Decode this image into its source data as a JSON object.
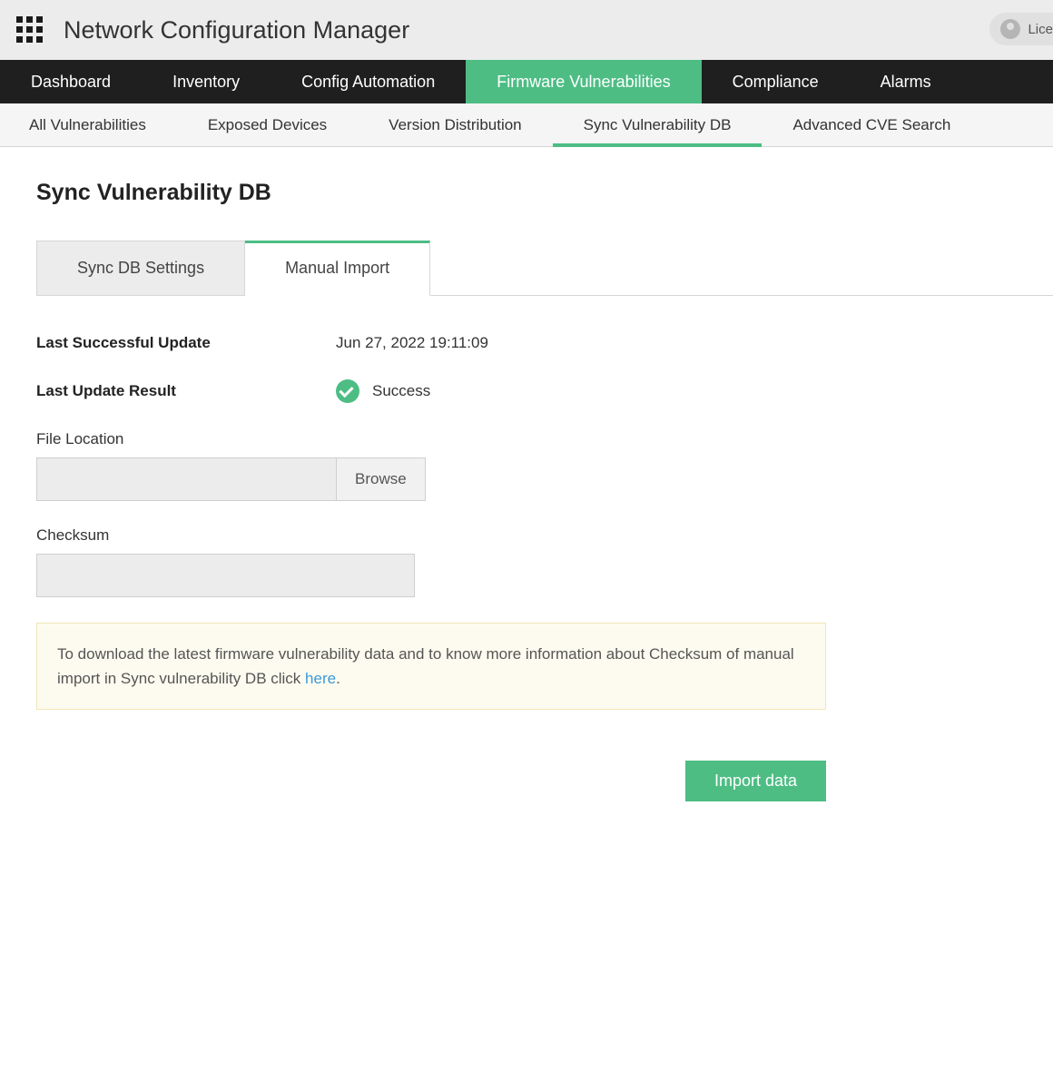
{
  "header": {
    "app_title": "Network Configuration Manager",
    "license_label": "Lice"
  },
  "main_nav": {
    "items": [
      {
        "label": "Dashboard",
        "active": false
      },
      {
        "label": "Inventory",
        "active": false
      },
      {
        "label": "Config Automation",
        "active": false
      },
      {
        "label": "Firmware Vulnerabilities",
        "active": true
      },
      {
        "label": "Compliance",
        "active": false
      },
      {
        "label": "Alarms",
        "active": false
      }
    ]
  },
  "sub_nav": {
    "items": [
      {
        "label": "All Vulnerabilities",
        "active": false
      },
      {
        "label": "Exposed Devices",
        "active": false
      },
      {
        "label": "Version Distribution",
        "active": false
      },
      {
        "label": "Sync Vulnerability DB",
        "active": true
      },
      {
        "label": "Advanced CVE Search",
        "active": false
      }
    ]
  },
  "page": {
    "title": "Sync Vulnerability DB",
    "tabs": [
      {
        "label": "Sync DB Settings",
        "active": false
      },
      {
        "label": "Manual Import",
        "active": true
      }
    ],
    "last_update_label": "Last Successful Update",
    "last_update_value": "Jun 27, 2022 19:11:09",
    "last_result_label": "Last Update Result",
    "last_result_value": "Success",
    "file_location_label": "File Location",
    "file_location_value": "",
    "browse_label": "Browse",
    "checksum_label": "Checksum",
    "checksum_value": "",
    "info_text_a": "To download the latest firmware vulnerability data and to know more information about Checksum of manual import in Sync vulnerability DB click ",
    "info_link": "here",
    "info_text_b": ".",
    "import_label": "Import data"
  }
}
